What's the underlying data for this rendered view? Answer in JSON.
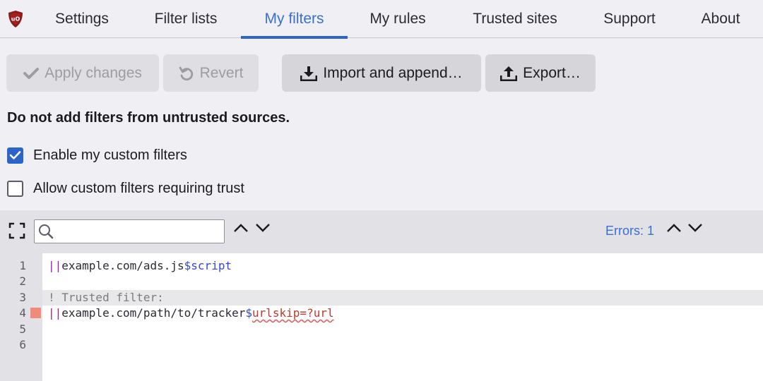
{
  "tabs": [
    {
      "label": "Settings",
      "active": false
    },
    {
      "label": "Filter lists",
      "active": false
    },
    {
      "label": "My filters",
      "active": true
    },
    {
      "label": "My rules",
      "active": false
    },
    {
      "label": "Trusted sites",
      "active": false
    },
    {
      "label": "Support",
      "active": false
    },
    {
      "label": "About",
      "active": false
    }
  ],
  "logo_icon": "ublock-shield-icon",
  "toolbar": {
    "apply_label": "Apply changes",
    "revert_label": "Revert",
    "import_label": "Import and append…",
    "export_label": "Export…"
  },
  "warning": "Do not add filters from untrusted sources.",
  "options": {
    "enable_label": "Enable my custom filters",
    "enable_checked": true,
    "trust_label": "Allow custom filters requiring trust",
    "trust_checked": false
  },
  "editor_toolbar": {
    "search_value": "",
    "errors_label": "Errors: 1"
  },
  "editor": {
    "line_numbers": [
      "1",
      "2",
      "3",
      "4",
      "5",
      "6"
    ],
    "lines": {
      "l1_bars": "||",
      "l1_domain": "example.com/ads.js",
      "l1_option": "$script",
      "l3_comment": "! Trusted filter:",
      "l4_bars": "||",
      "l4_domain": "example.com/path/to/tracker",
      "l4_dollar": "$",
      "l4_option": "urlskip=?url"
    },
    "error_line": "4"
  },
  "colors": {
    "accent": "#2d64c8",
    "active_tab_text": "#3a6fd1",
    "error_marker": "#f08a7a"
  }
}
